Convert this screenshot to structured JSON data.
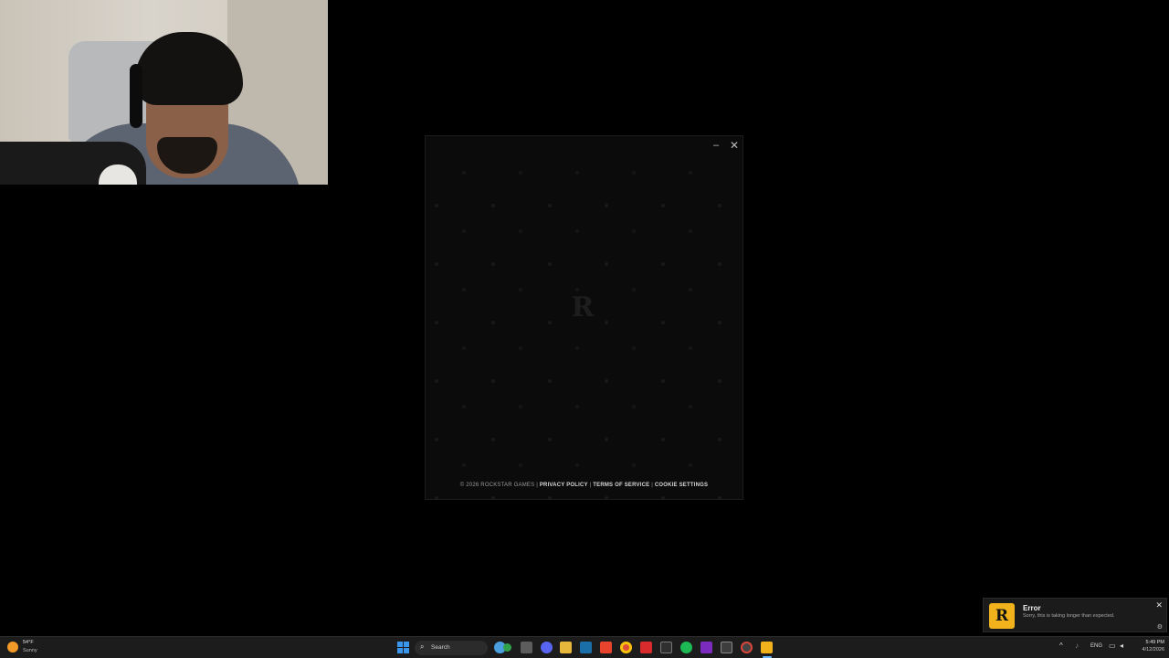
{
  "launcher": {
    "footer": {
      "copyright": "© 2026 ROCKSTAR GAMES",
      "sep1": " | ",
      "privacy": "PRIVACY POLICY",
      "sep2": " | ",
      "terms": "TERMS OF SERVICE",
      "sep3": " | ",
      "cookies": "COOKIE SETTINGS"
    },
    "min_glyph": "–",
    "close_glyph": "✕"
  },
  "toast": {
    "title": "Error",
    "message": "Sorry, this is taking longer than expected.",
    "close_glyph": "✕",
    "app_icon": "rockstar-logo-icon",
    "accent": "#f2b21b"
  },
  "taskbar": {
    "weather": {
      "temp": "54°F",
      "condition": "Sunny"
    },
    "search_label": "Search",
    "language": "ENG",
    "time": "5:49 PM",
    "date": "4/12/2026",
    "pinned_icons": [
      "file-explorer-icon",
      "chrome-icon",
      "task-view-icon",
      "discord-icon",
      "folder-icon",
      "steam-icon",
      "brave-icon",
      "chrome-icon",
      "acrobat-icon",
      "epic-games-icon",
      "spotify-icon",
      "nzxt-icon",
      "xbox-icon",
      "rockstar-launcher-icon"
    ],
    "accent": "#3a96ea"
  }
}
